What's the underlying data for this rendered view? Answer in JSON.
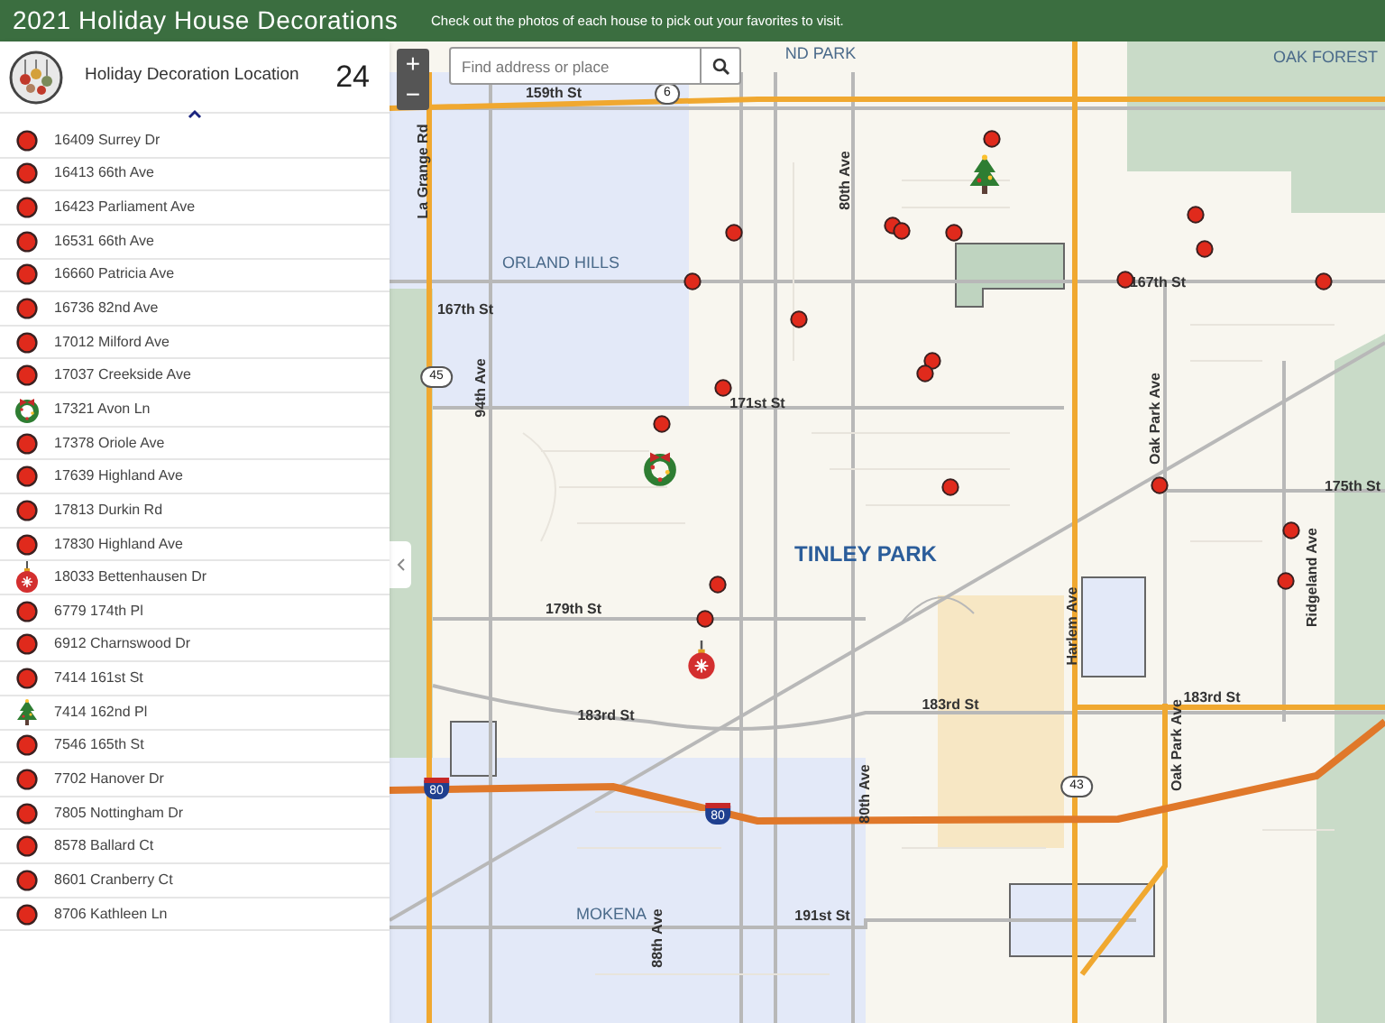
{
  "header": {
    "title": "2021 Holiday House Decorations",
    "subtitle": "Check out the photos of each house to pick out your favorites to visit."
  },
  "panel": {
    "title": "Holiday Decoration Location",
    "count": "24",
    "items": [
      {
        "address": "16409 Surrey Dr",
        "kind": "dot"
      },
      {
        "address": "16413 66th Ave",
        "kind": "dot"
      },
      {
        "address": "16423 Parliament Ave",
        "kind": "dot"
      },
      {
        "address": "16531 66th Ave",
        "kind": "dot"
      },
      {
        "address": "16660 Patricia Ave",
        "kind": "dot"
      },
      {
        "address": "16736 82nd Ave",
        "kind": "dot"
      },
      {
        "address": "17012 Milford Ave",
        "kind": "dot"
      },
      {
        "address": "17037 Creekside Ave",
        "kind": "dot"
      },
      {
        "address": "17321 Avon Ln",
        "kind": "wreath"
      },
      {
        "address": "17378 Oriole Ave",
        "kind": "dot"
      },
      {
        "address": "17639 Highland Ave",
        "kind": "dot"
      },
      {
        "address": "17813 Durkin Rd",
        "kind": "dot"
      },
      {
        "address": "17830 Highland Ave",
        "kind": "dot"
      },
      {
        "address": "18033 Bettenhausen Dr",
        "kind": "ornament"
      },
      {
        "address": "6779 174th Pl",
        "kind": "dot"
      },
      {
        "address": "6912 Charnswood Dr",
        "kind": "dot"
      },
      {
        "address": "7414 161st St",
        "kind": "dot"
      },
      {
        "address": "7414 162nd Pl",
        "kind": "tree"
      },
      {
        "address": "7546 165th St",
        "kind": "dot"
      },
      {
        "address": "7702 Hanover Dr",
        "kind": "dot"
      },
      {
        "address": "7805 Nottingham Dr",
        "kind": "dot"
      },
      {
        "address": "8578 Ballard Ct",
        "kind": "dot"
      },
      {
        "address": "8601 Cranberry Ct",
        "kind": "dot"
      },
      {
        "address": "8706 Kathleen Ln",
        "kind": "dot"
      }
    ]
  },
  "search": {
    "placeholder": "Find address or place"
  },
  "zoom": {
    "in": "+",
    "out": "−"
  },
  "map": {
    "labels": [
      {
        "text": "ND PARK",
        "kind": "place"
      },
      {
        "text": "OAK FOREST",
        "kind": "place"
      },
      {
        "text": "159th St",
        "kind": "street"
      },
      {
        "text": "6",
        "kind": "state_shield"
      },
      {
        "text": "La Grange Rd",
        "kind": "street_vertical"
      },
      {
        "text": "ORLAND HILLS",
        "kind": "place"
      },
      {
        "text": "80th Ave",
        "kind": "street_vertical"
      },
      {
        "text": "167th St",
        "kind": "street"
      },
      {
        "text": "167th St",
        "kind": "street"
      },
      {
        "text": "45",
        "kind": "state_shield"
      },
      {
        "text": "94th Ave",
        "kind": "street_vertical"
      },
      {
        "text": "171st St",
        "kind": "street"
      },
      {
        "text": "Oak Park Ave",
        "kind": "street_vertical"
      },
      {
        "text": "175th St",
        "kind": "street"
      },
      {
        "text": "Ridgeland Ave",
        "kind": "street_vertical"
      },
      {
        "text": "TINLEY PARK",
        "kind": "city"
      },
      {
        "text": "179th St",
        "kind": "street"
      },
      {
        "text": "183rd St",
        "kind": "street"
      },
      {
        "text": "183rd St",
        "kind": "street"
      },
      {
        "text": "183rd St",
        "kind": "street"
      },
      {
        "text": "Harlem Ave",
        "kind": "street_vertical"
      },
      {
        "text": "80",
        "kind": "interstate_shield"
      },
      {
        "text": "80",
        "kind": "interstate_shield"
      },
      {
        "text": "80th Ave",
        "kind": "street_vertical"
      },
      {
        "text": "43",
        "kind": "state_shield"
      },
      {
        "text": "Oak Park Ave",
        "kind": "street_vertical"
      },
      {
        "text": "MOKENA",
        "kind": "place"
      },
      {
        "text": "191st St",
        "kind": "street"
      },
      {
        "text": "88th Ave",
        "kind": "street_vertical"
      }
    ]
  }
}
